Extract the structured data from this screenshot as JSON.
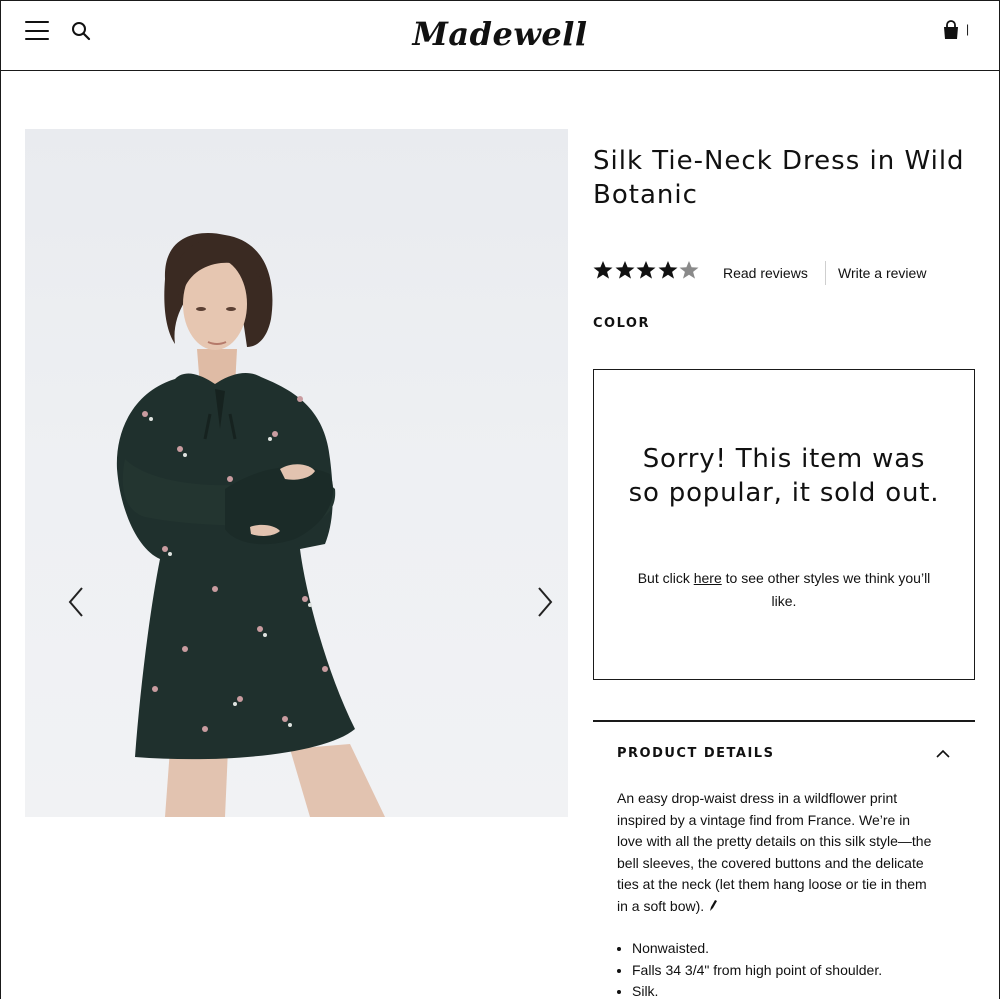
{
  "header": {
    "logo_text": "Madewell",
    "bag_count": "|",
    "icons": [
      "hamburger-menu-icon",
      "search-icon",
      "shopping-bag-icon"
    ]
  },
  "product": {
    "title": "Silk Tie-Neck Dress in Wild Botanic",
    "rating": {
      "value": 4,
      "max": 5
    },
    "read_reviews_label": "Read reviews",
    "write_review_label": "Write a review",
    "color_label": "COLOR"
  },
  "gallery": {
    "prev_icon": "chevron-left-icon",
    "next_icon": "chevron-right-icon"
  },
  "soldout": {
    "heading": "Sorry! This item was so popular, it sold out.",
    "sub_before": "But click ",
    "sub_link": "here",
    "sub_after": " to see other styles we think you’ll like."
  },
  "details": {
    "title": "PRODUCT DETAILS",
    "description": "An easy drop-waist dress in a wildflower print inspired by a vintage find from France. We’re in love with all the pretty details on this silk style—the bell sleeves, the covered buttons and the delicate ties at the neck (let them hang loose or tie in them in a soft bow). ",
    "bullets": [
      "Nonwaisted.",
      "Falls 34 3/4\" from high point of shoulder.",
      "Silk."
    ]
  },
  "colors": {
    "border": "#1a1a1a",
    "text": "#111111",
    "star_filled": "#111111",
    "star_empty": "#8a8a8a",
    "image_bg": "#eceef2",
    "dress": "#1f302d"
  }
}
